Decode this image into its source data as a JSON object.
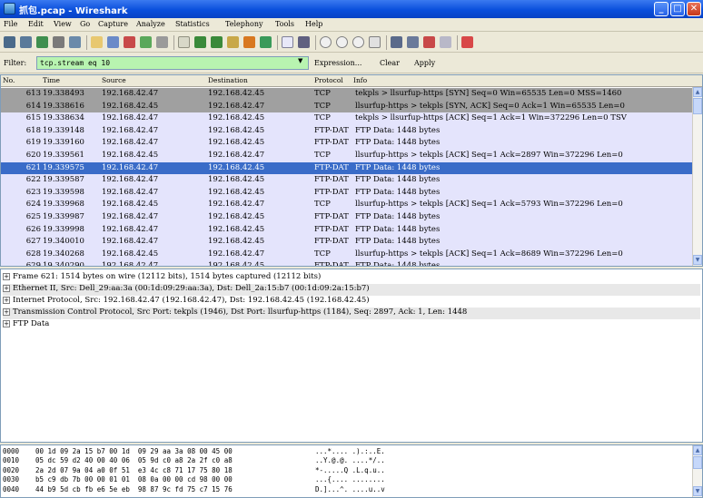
{
  "window": {
    "title": "抓包.pcap - Wireshark"
  },
  "menu": [
    "File",
    "Edit",
    "View",
    "Go",
    "Capture",
    "Analyze",
    "Statistics",
    "Telephony",
    "Tools",
    "Help"
  ],
  "filter": {
    "label": "Filter:",
    "value": "tcp.stream eq 10",
    "expression_label": "Expression...",
    "clear_label": "Clear",
    "apply_label": "Apply"
  },
  "packet_list": {
    "columns": [
      "No.",
      "Time",
      "Source",
      "Destination",
      "Protocol",
      "Info"
    ],
    "rows": [
      {
        "no": "613",
        "time": "19.338493",
        "src": "192.168.42.47",
        "dst": "192.168.42.45",
        "proto": "TCP",
        "info": "tekpls > llsurfup-https [SYN] Seq=0 Win=65535 Len=0 MSS=1460",
        "style": "syn"
      },
      {
        "no": "614",
        "time": "19.338616",
        "src": "192.168.42.45",
        "dst": "192.168.42.47",
        "proto": "TCP",
        "info": "llsurfup-https > tekpls [SYN, ACK] Seq=0 Ack=1 Win=65535 Len=0",
        "style": "syn"
      },
      {
        "no": "615",
        "time": "19.338634",
        "src": "192.168.42.47",
        "dst": "192.168.42.45",
        "proto": "TCP",
        "info": "tekpls > llsurfup-https [ACK] Seq=1 Ack=1 Win=372296 Len=0 TSV",
        "style": "norm"
      },
      {
        "no": "618",
        "time": "19.339148",
        "src": "192.168.42.47",
        "dst": "192.168.42.45",
        "proto": "FTP-DAT",
        "info": "FTP Data: 1448 bytes",
        "style": "norm"
      },
      {
        "no": "619",
        "time": "19.339160",
        "src": "192.168.42.47",
        "dst": "192.168.42.45",
        "proto": "FTP-DAT",
        "info": "FTP Data: 1448 bytes",
        "style": "norm"
      },
      {
        "no": "620",
        "time": "19.339561",
        "src": "192.168.42.45",
        "dst": "192.168.42.47",
        "proto": "TCP",
        "info": "llsurfup-https > tekpls [ACK] Seq=1 Ack=2897 Win=372296 Len=0",
        "style": "norm"
      },
      {
        "no": "621",
        "time": "19.339575",
        "src": "192.168.42.47",
        "dst": "192.168.42.45",
        "proto": "FTP-DAT",
        "info": "FTP Data: 1448 bytes",
        "style": "sel"
      },
      {
        "no": "622",
        "time": "19.339587",
        "src": "192.168.42.47",
        "dst": "192.168.42.45",
        "proto": "FTP-DAT",
        "info": "FTP Data: 1448 bytes",
        "style": "norm"
      },
      {
        "no": "623",
        "time": "19.339598",
        "src": "192.168.42.47",
        "dst": "192.168.42.45",
        "proto": "FTP-DAT",
        "info": "FTP Data: 1448 bytes",
        "style": "norm"
      },
      {
        "no": "624",
        "time": "19.339968",
        "src": "192.168.42.45",
        "dst": "192.168.42.47",
        "proto": "TCP",
        "info": "llsurfup-https > tekpls [ACK] Seq=1 Ack=5793 Win=372296 Len=0",
        "style": "norm"
      },
      {
        "no": "625",
        "time": "19.339987",
        "src": "192.168.42.47",
        "dst": "192.168.42.45",
        "proto": "FTP-DAT",
        "info": "FTP Data: 1448 bytes",
        "style": "norm"
      },
      {
        "no": "626",
        "time": "19.339998",
        "src": "192.168.42.47",
        "dst": "192.168.42.45",
        "proto": "FTP-DAT",
        "info": "FTP Data: 1448 bytes",
        "style": "norm"
      },
      {
        "no": "627",
        "time": "19.340010",
        "src": "192.168.42.47",
        "dst": "192.168.42.45",
        "proto": "FTP-DAT",
        "info": "FTP Data: 1448 bytes",
        "style": "norm"
      },
      {
        "no": "628",
        "time": "19.340268",
        "src": "192.168.42.45",
        "dst": "192.168.42.47",
        "proto": "TCP",
        "info": "llsurfup-https > tekpls [ACK] Seq=1 Ack=8689 Win=372296 Len=0",
        "style": "norm"
      },
      {
        "no": "629",
        "time": "19.340290",
        "src": "192.168.42.47",
        "dst": "192.168.42.45",
        "proto": "FTP-DAT",
        "info": "FTP Data: 1448 bytes",
        "style": "norm"
      }
    ]
  },
  "details": [
    "Frame 621: 1514 bytes on wire (12112 bits), 1514 bytes captured (12112 bits)",
    "Ethernet II, Src: Dell_29:aa:3a (00:1d:09:29:aa:3a), Dst: Dell_2a:15:b7 (00:1d:09:2a:15:b7)",
    "Internet Protocol, Src: 192.168.42.47 (192.168.42.47), Dst: 192.168.42.45 (192.168.42.45)",
    "Transmission Control Protocol, Src Port: tekpls (1946), Dst Port: llsurfup-https (1184), Seq: 2897, Ack: 1, Len: 1448",
    "FTP Data"
  ],
  "hex": [
    {
      "off": "0000",
      "bytes": "00 1d 09 2a 15 b7 00 1d  09 29 aa 3a 08 00 45 00",
      "ascii": "...*.... .).:..E."
    },
    {
      "off": "0010",
      "bytes": "05 dc 59 d2 40 00 40 06  05 9d c0 a8 2a 2f c0 a8",
      "ascii": "..Y.@.@. ....*/.."
    },
    {
      "off": "0020",
      "bytes": "2a 2d 07 9a 04 a0 0f 51  e3 4c c8 71 17 75 80 18",
      "ascii": "*-.....Q .L.q.u.."
    },
    {
      "off": "0030",
      "bytes": "b5 c9 db 7b 00 00 01 01  08 0a 00 00 cd 98 00 00",
      "ascii": "...{.... ........"
    },
    {
      "off": "0040",
      "bytes": "44 b9 5d cb fb e6 5e eb  98 87 9c fd 75 c7 15 76",
      "ascii": "D.]...^. ....u..v"
    }
  ]
}
